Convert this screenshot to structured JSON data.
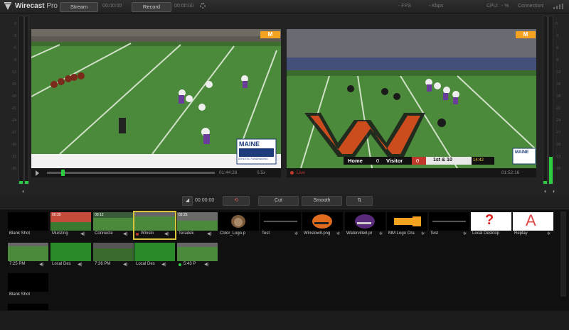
{
  "app": {
    "name": "Wirecast",
    "edition": "Pro"
  },
  "toolbar": {
    "stream_label": "Stream",
    "stream_time": "00:00:00",
    "record_label": "Record",
    "record_time": "00:00:00"
  },
  "stats": {
    "fps": "- FPS",
    "kbps": "- Kbps",
    "cpu": "CPU:",
    "cpu_value": "- %",
    "connection": "Connection:"
  },
  "meter_scale": [
    "0",
    "-3",
    "-6",
    "-9",
    "-12",
    "-15",
    "-18",
    "-21",
    "-24",
    "-27",
    "-30",
    "-33",
    "-36"
  ],
  "preview": {
    "time": "01:44:28",
    "zoom": "0.5x"
  },
  "program": {
    "status": "Live",
    "time": "01:52:16"
  },
  "scoreboard": {
    "home_label": "Home",
    "home_score": "0",
    "visitor_label": "Visitor",
    "visitor_score": "0",
    "down": "1st & 10",
    "clock": "14:42"
  },
  "overlays": {
    "logo_text": "MAINE",
    "logo_sub": "ATHLETIC FUNDRAISING",
    "m_text": "M"
  },
  "transition": {
    "time": "00:00:00",
    "cut_label": "Cut",
    "smooth_label": "Smooth"
  },
  "shots_row1": [
    {
      "label": "Blank Shot",
      "duration": ""
    },
    {
      "label": "Munzing",
      "duration": "00:30"
    },
    {
      "label": "Connecte",
      "duration": "00:12"
    },
    {
      "label": "Winslo",
      "duration": ""
    },
    {
      "label": "Teradek",
      "duration": "02:26"
    },
    {
      "label": "Color_Logo.p",
      "duration": ""
    },
    {
      "label": "Test",
      "duration": ""
    },
    {
      "label": "Winslow8.png",
      "duration": ""
    },
    {
      "label": "Waterville8.pr",
      "duration": ""
    },
    {
      "label": "MM Logo Ora",
      "duration": ""
    },
    {
      "label": "Test",
      "duration": ""
    },
    {
      "label": "Local Desktop",
      "duration": ""
    },
    {
      "label": "Replay",
      "duration": ""
    }
  ],
  "shots_row2": [
    {
      "label": "7:25 PM"
    },
    {
      "label": "Local Des"
    },
    {
      "label": "7:36 PM"
    },
    {
      "label": "Local Des"
    },
    {
      "label": "5:43 P"
    }
  ],
  "shots_row3": [
    {
      "label": "Blank Shot"
    }
  ],
  "glyphs": {
    "question": "?",
    "replay_letter": "A"
  },
  "colors": {
    "accent_yellow": "#d9c43a",
    "live_red": "#c0392b",
    "meter_green": "#2ecc40",
    "field_green": "#4a8a3a"
  }
}
